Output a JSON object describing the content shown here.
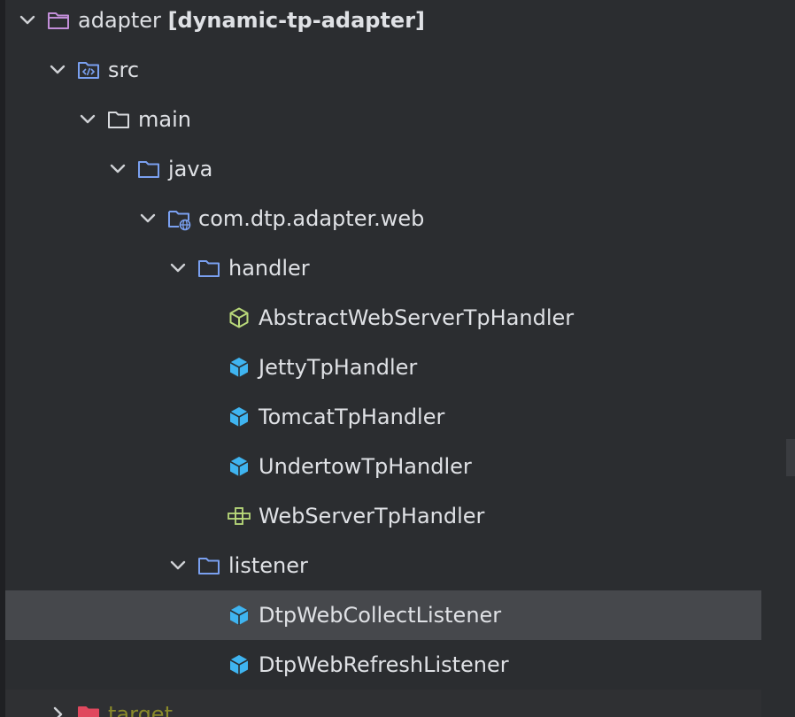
{
  "tree": {
    "root": {
      "name": "adapter",
      "module": "[dynamic-tp-adapter]"
    },
    "src": {
      "label": "src"
    },
    "main": {
      "label": "main"
    },
    "java": {
      "label": "java"
    },
    "package": {
      "label": "com.dtp.adapter.web"
    },
    "handler": {
      "label": "handler",
      "items": [
        {
          "label": "AbstractWebServerTpHandler",
          "icon": "abstract-class-icon"
        },
        {
          "label": "JettyTpHandler",
          "icon": "class-icon"
        },
        {
          "label": "TomcatTpHandler",
          "icon": "class-icon"
        },
        {
          "label": "UndertowTpHandler",
          "icon": "class-icon"
        },
        {
          "label": "WebServerTpHandler",
          "icon": "interface-icon"
        }
      ]
    },
    "listener": {
      "label": "listener",
      "items": [
        {
          "label": "DtpWebCollectListener",
          "icon": "class-icon",
          "selected": true
        },
        {
          "label": "DtpWebRefreshListener",
          "icon": "class-icon"
        }
      ]
    },
    "target": {
      "label": "target"
    }
  },
  "colors": {
    "background": "#2b2d30",
    "selected_row": "#46484c",
    "text": "#dfe1e5",
    "folder_blue": "#7aa0f0",
    "module_purple": "#c28ed8",
    "class_blue": "#3fb4f0",
    "abstract_green": "#b9d97a",
    "excluded_red": "#e0485e"
  }
}
